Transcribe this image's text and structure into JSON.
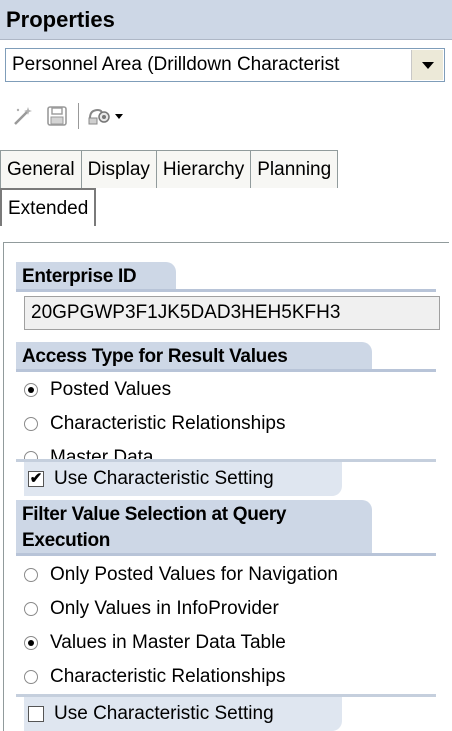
{
  "panel": {
    "title": "Properties"
  },
  "selector": {
    "value": "Personnel Area (Drilldown Characterist"
  },
  "toolbar": {
    "icons": [
      "magic-wand-icon",
      "save-icon",
      "query-designer-icon"
    ]
  },
  "tabs": {
    "row1": [
      "General",
      "Display",
      "Hierarchy",
      "Planning"
    ],
    "row2": [
      "Extended"
    ],
    "active": "Extended"
  },
  "enterprise_id": {
    "header": "Enterprise ID",
    "value": "20GPGWP3F1JK5DAD3HEH5KFH3"
  },
  "access_type": {
    "header": "Access Type for Result Values",
    "options": [
      {
        "label": "Posted Values",
        "selected": true
      },
      {
        "label": "Characteristic Relationships",
        "selected": false
      },
      {
        "label": "Master Data",
        "selected": false
      }
    ],
    "use_setting": {
      "label": "Use Characteristic Setting",
      "checked": true
    }
  },
  "filter_value": {
    "header_line1": "Filter Value Selection at Query",
    "header_line2": "Execution",
    "options": [
      {
        "label": "Only Posted Values for Navigation",
        "selected": false
      },
      {
        "label": "Only Values in InfoProvider",
        "selected": false
      },
      {
        "label": "Values in Master Data Table",
        "selected": true
      },
      {
        "label": "Characteristic Relationships",
        "selected": false
      }
    ],
    "use_setting": {
      "label": "Use Characteristic Setting",
      "checked": false
    }
  }
}
